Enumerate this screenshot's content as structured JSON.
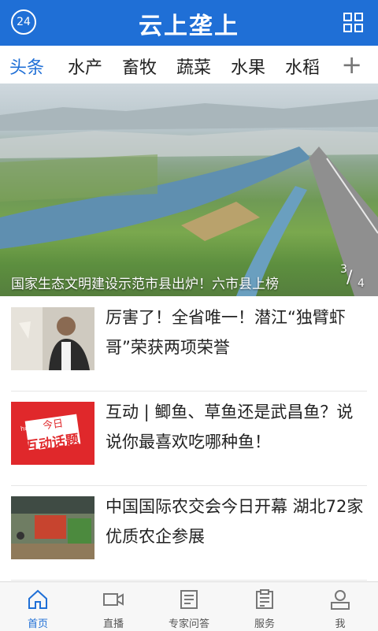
{
  "header": {
    "badge": "24",
    "logo_text": "云上垄上",
    "accent": "#1f6fd6"
  },
  "tabs": [
    {
      "label": "头条",
      "active": true
    },
    {
      "label": "水产",
      "active": false
    },
    {
      "label": "畜牧",
      "active": false
    },
    {
      "label": "蔬菜",
      "active": false
    },
    {
      "label": "水果",
      "active": false
    },
    {
      "label": "水稻",
      "active": false
    }
  ],
  "tabs_more": "+",
  "banner": {
    "caption": "国家生态文明建设示范市县出炉！六市县上榜",
    "page_current": "3",
    "page_total": "4"
  },
  "news": [
    {
      "title": "厉害了！全省唯一！潜江“独臂虾哥”荣获两项荣誉",
      "thumb": "person-photo"
    },
    {
      "title": "互动 | 鲫鱼、草鱼还是武昌鱼？说说你最喜欢吃哪种鱼！",
      "thumb": "topic-card",
      "thumb_text_top": "今日",
      "thumb_text_main": "互动话题",
      "thumb_brand": "hudong"
    },
    {
      "title": "中国国际农交会今日开幕 湖北72家优质农企参展",
      "thumb": "expo-photo"
    }
  ],
  "bottom_nav": [
    {
      "label": "首页",
      "icon": "home-icon",
      "active": true
    },
    {
      "label": "直播",
      "icon": "video-icon",
      "active": false
    },
    {
      "label": "专家问答",
      "icon": "document-icon",
      "active": false
    },
    {
      "label": "服务",
      "icon": "clipboard-icon",
      "active": false
    },
    {
      "label": "我",
      "icon": "user-icon",
      "active": false
    }
  ]
}
